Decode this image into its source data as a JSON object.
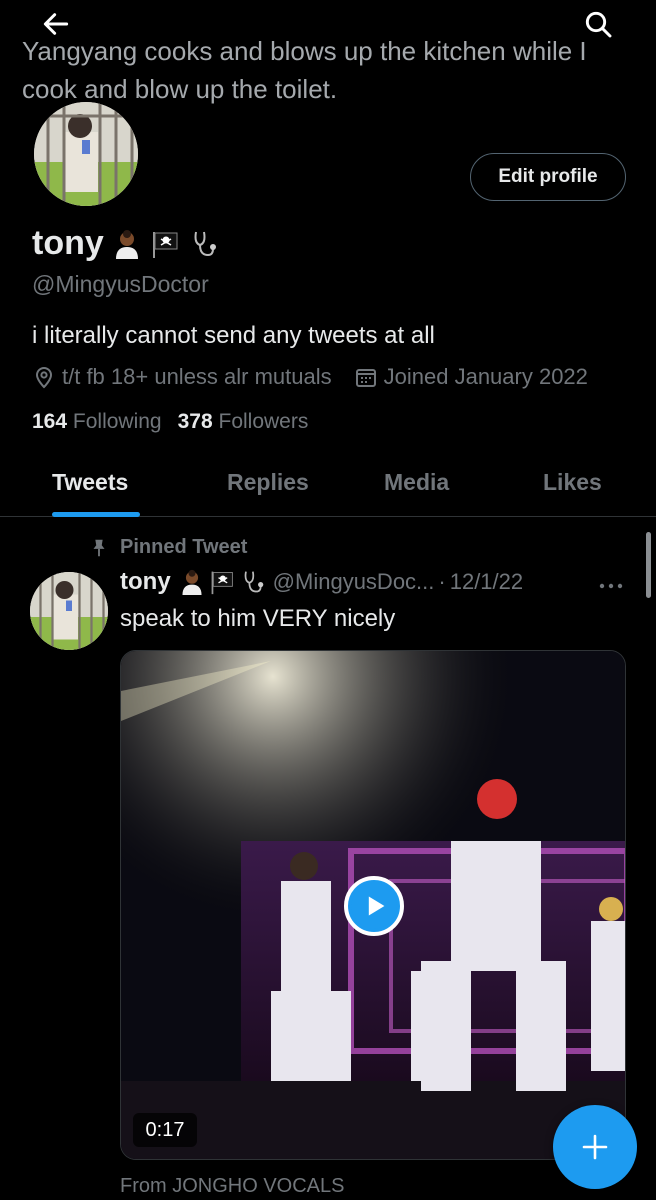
{
  "header": {
    "text": "Yangyang cooks and blows up the kitchen while I cook and blow up the toilet."
  },
  "profile": {
    "display_name": "tony",
    "handle": "@MingyusDoctor",
    "bio": "i literally cannot send any tweets at all",
    "location": "t/t fb 18+ unless alr mutuals",
    "joined": "Joined January 2022",
    "following_count": "164",
    "following_label": "Following",
    "followers_count": "378",
    "followers_label": "Followers",
    "edit_label": "Edit profile",
    "name_emojis": [
      "doctor-emoji",
      "pirate-flag-emoji",
      "stethoscope-emoji"
    ]
  },
  "tabs": [
    {
      "label": "Tweets",
      "active": true
    },
    {
      "label": "Replies",
      "active": false
    },
    {
      "label": "Media",
      "active": false
    },
    {
      "label": "Likes",
      "active": false
    }
  ],
  "pinned_tweet": {
    "pinned_label": "Pinned Tweet",
    "author": "tony",
    "handle": "@MingyusDoc...",
    "date": "12/1/22",
    "separator": "·",
    "text": "speak to him VERY nicely",
    "video_duration": "0:17",
    "source": "From JONGHO VOCALS"
  },
  "colors": {
    "accent": "#1d9bf0",
    "background": "#000000",
    "text_primary": "#e7e9ea",
    "text_secondary": "#71767b"
  }
}
